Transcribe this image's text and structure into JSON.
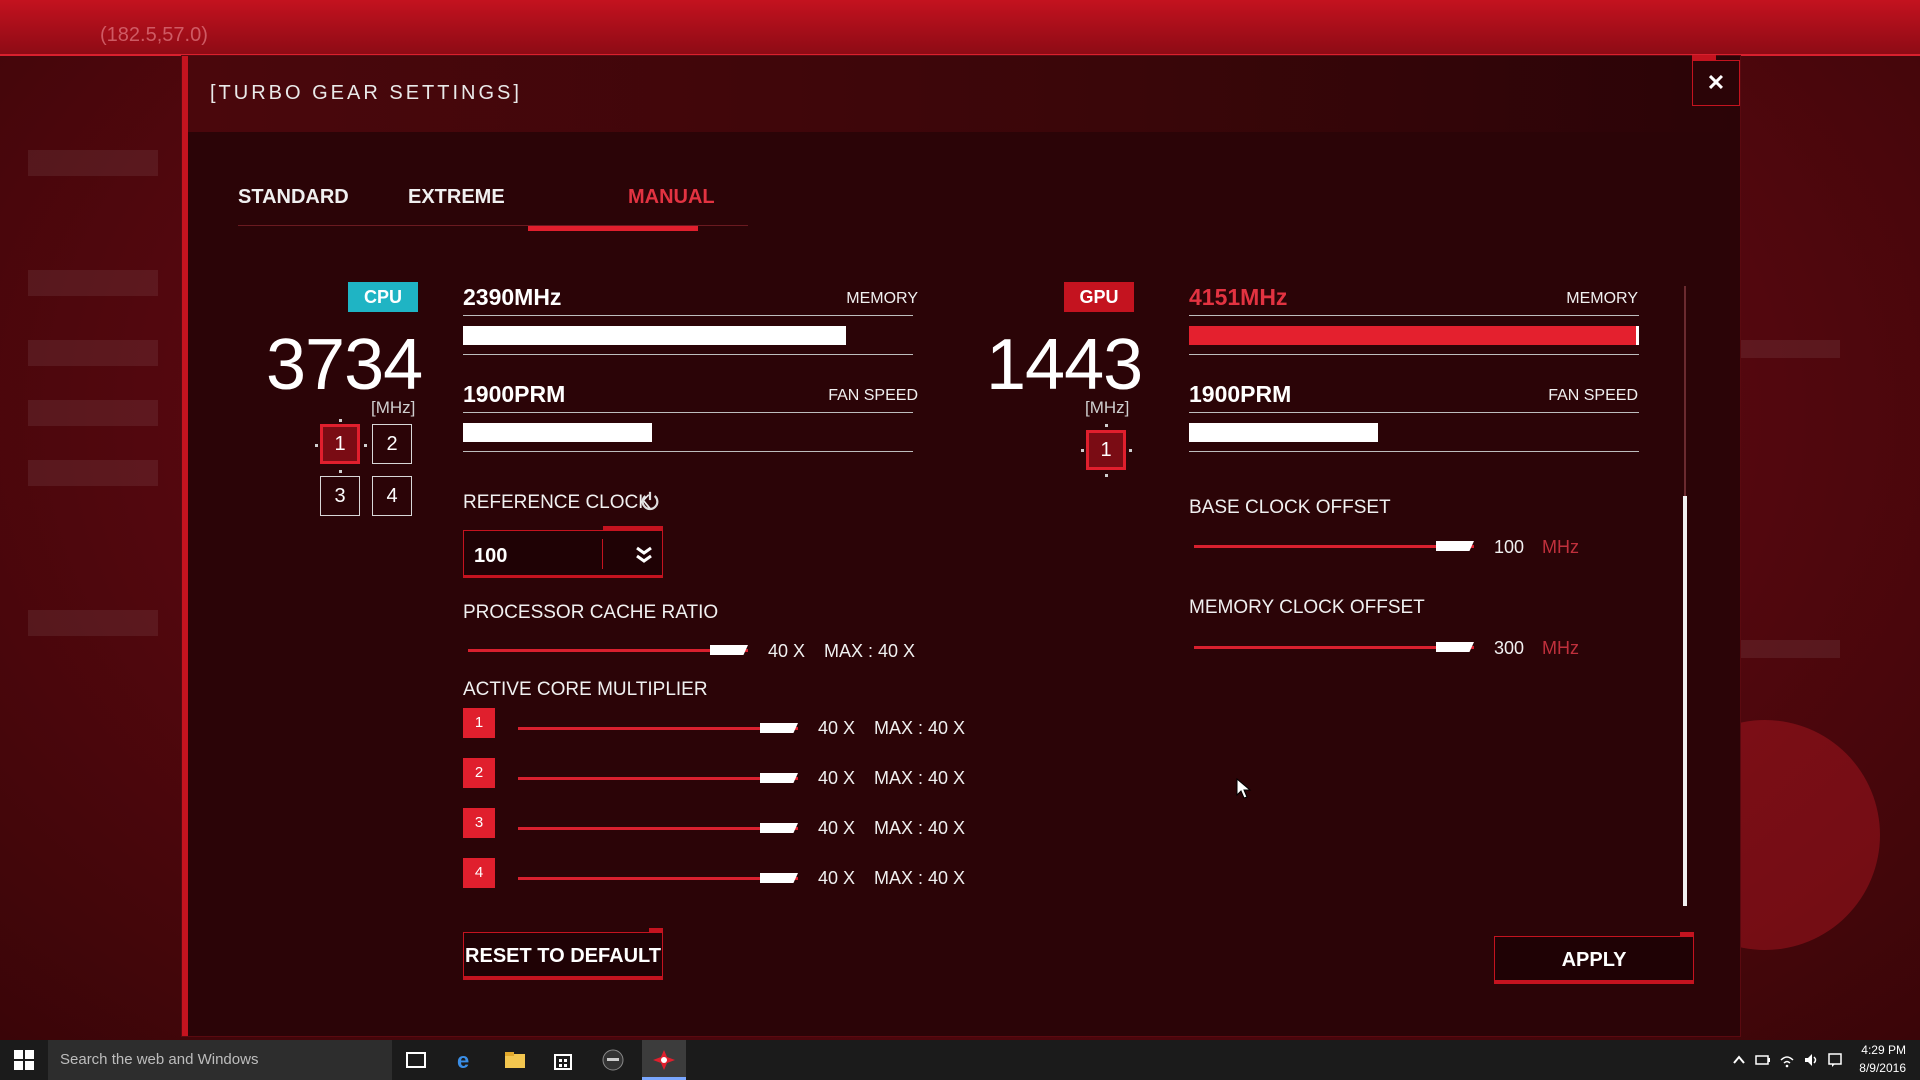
{
  "background": {
    "coords": "(182.5,57.0)"
  },
  "dialog": {
    "title": "[TURBO GEAR SETTINGS]",
    "close_label": "✕"
  },
  "tabs": [
    {
      "label": "STANDARD",
      "active": false
    },
    {
      "label": "EXTREME",
      "active": false
    },
    {
      "label": "MANUAL",
      "active": true
    }
  ],
  "cpu": {
    "badge": "CPU",
    "frequency": "3734",
    "unit": "[MHz]",
    "cores": [
      "1",
      "2",
      "3",
      "4"
    ],
    "selected_core": "1",
    "memory": {
      "value": "2390MHz",
      "label": "MEMORY",
      "fill": 0.85
    },
    "fan": {
      "value": "1900PRM",
      "label": "FAN SPEED",
      "fill": 0.42
    },
    "reference_clock": {
      "label": "REFERENCE CLOCK",
      "value": "100"
    },
    "cache_ratio": {
      "label": "PROCESSOR CACHE RATIO",
      "value": "40 X",
      "max": "MAX : 40 X",
      "level": 1.0
    },
    "core_multiplier": {
      "label": "ACTIVE CORE MULTIPLIER",
      "rows": [
        {
          "n": "1",
          "value": "40 X",
          "max": "MAX : 40 X",
          "level": 1.0
        },
        {
          "n": "2",
          "value": "40 X",
          "max": "MAX : 40 X",
          "level": 1.0
        },
        {
          "n": "3",
          "value": "40 X",
          "max": "MAX : 40 X",
          "level": 1.0
        },
        {
          "n": "4",
          "value": "40 X",
          "max": "MAX : 40 X",
          "level": 1.0
        }
      ]
    },
    "reset_label": "RESET TO DEFAULT"
  },
  "gpu": {
    "badge": "GPU",
    "frequency": "1443",
    "unit": "[MHz]",
    "cores": [
      "1"
    ],
    "memory": {
      "value": "4151MHz",
      "label": "MEMORY",
      "fill": 1.0
    },
    "fan": {
      "value": "1900PRM",
      "label": "FAN SPEED",
      "fill": 0.42
    },
    "base_clock_offset": {
      "label": "BASE CLOCK OFFSET",
      "value": "100",
      "unit": "MHz",
      "level": 1.0
    },
    "memory_clock_offset": {
      "label": "MEMORY CLOCK OFFSET",
      "value": "300",
      "unit": "MHz",
      "level": 1.0
    },
    "apply_label": "APPLY"
  },
  "taskbar": {
    "search_placeholder": "Search the web and Windows",
    "time": "4:29 PM",
    "date": "8/9/2016"
  },
  "colors": {
    "accent": "#e01f2d",
    "cpu_badge": "#1fb4c4",
    "gpu_badge": "#c4131f"
  }
}
